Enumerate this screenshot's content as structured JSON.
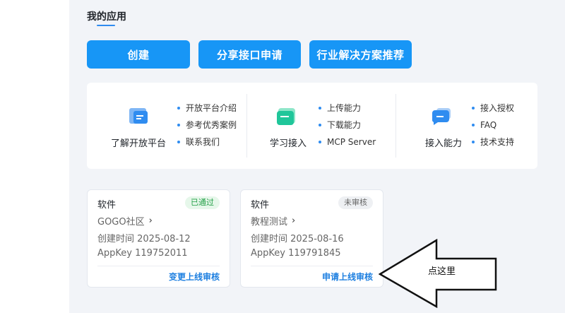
{
  "section": {
    "title": "我的应用"
  },
  "buttons": {
    "create": "创建",
    "share": "分享接口申请",
    "industry": "行业解决方案推荐"
  },
  "info": {
    "groups": [
      {
        "label": "了解开放平台",
        "icon": "platform-icon",
        "links": [
          "开放平台介绍",
          "参考优秀案例",
          "联系我们"
        ]
      },
      {
        "label": "学习接入",
        "icon": "learn-icon",
        "links": [
          "上传能力",
          "下载能力",
          "MCP Server"
        ]
      },
      {
        "label": "接入能力",
        "icon": "chat-icon",
        "links": [
          "接入授权",
          "FAQ",
          "技术支持"
        ]
      }
    ]
  },
  "apps": [
    {
      "type": "软件",
      "status": "已通过",
      "name": "GOGO社区",
      "created": "创建时间 2025-08-12",
      "appkey": "AppKey 119752011",
      "action": "变更上线审核"
    },
    {
      "type": "软件",
      "status": "未审核",
      "name": "教程测试",
      "created": "创建时间 2025-08-16",
      "appkey": "AppKey 119791845",
      "action": "申请上线审核"
    }
  ],
  "annotation": {
    "text": "点这里"
  },
  "colors": {
    "primary": "#1796f6",
    "pass": "#23a047",
    "link": "#1d7fe0"
  }
}
